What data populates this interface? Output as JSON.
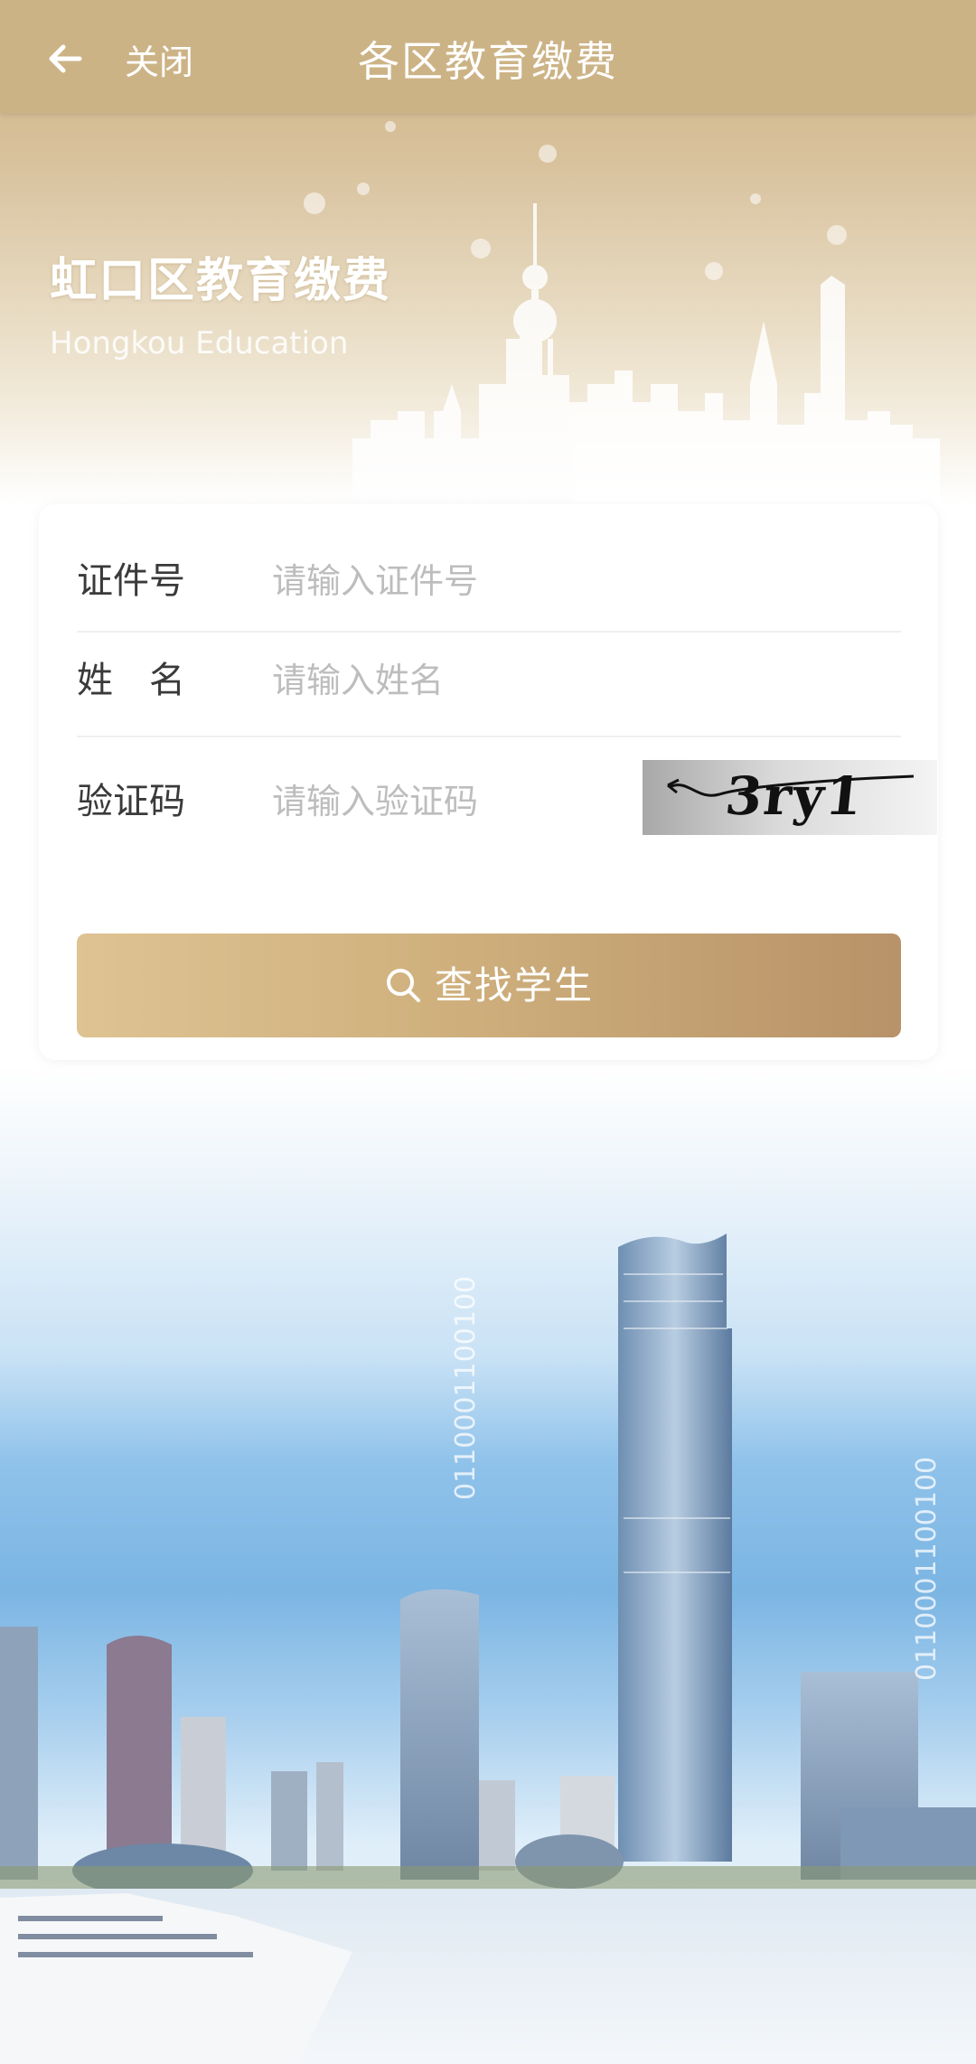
{
  "header": {
    "close_label": "关闭",
    "title": "各区教育缴费"
  },
  "hero": {
    "title": "虹口区教育缴费",
    "subtitle": "Hongkou Education"
  },
  "form": {
    "id_label": "证件号",
    "id_placeholder": "请输入证件号",
    "name_label": "姓　名",
    "name_placeholder": "请输入姓名",
    "code_label": "验证码",
    "code_placeholder": "请输入验证码",
    "captcha_text": "3ry1",
    "search_label": "查找学生"
  },
  "decor": {
    "binary_left": "0110001100100",
    "binary_right": "0110001100100"
  },
  "colors": {
    "header": "#ccb386",
    "button_start": "#dec393",
    "button_end": "#b89268"
  }
}
